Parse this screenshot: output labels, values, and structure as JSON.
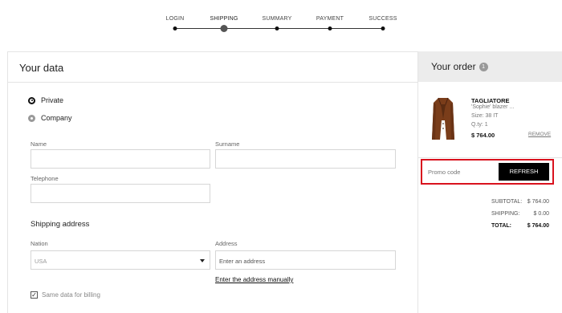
{
  "stepper": {
    "steps": [
      {
        "label": "LOGIN"
      },
      {
        "label": "SHIPPING"
      },
      {
        "label": "SUMMARY"
      },
      {
        "label": "PAYMENT"
      },
      {
        "label": "SUCCESS"
      }
    ]
  },
  "left": {
    "title": "Your data",
    "radio_private": "Private",
    "radio_company": "Company",
    "name_label": "Name",
    "surname_label": "Surname",
    "telephone_label": "Telephone",
    "shipping_title": "Shipping address",
    "nation_label": "Nation",
    "nation_value": "USA",
    "address_label": "Address",
    "address_placeholder": "Enter an address",
    "manual_link": "Enter the address manually",
    "billing_label": "Same data for billing",
    "billing_check": "✓"
  },
  "order": {
    "title": "Your order",
    "count": "1",
    "product": {
      "brand": "TAGLIATORE",
      "name": "'Sophie' blazer ...",
      "size": "Size: 38 IT",
      "qty": "Q.ty: 1",
      "price": "$ 764.00",
      "remove": "REMOVE"
    },
    "promo_placeholder": "Promo code",
    "refresh": "REFRESH",
    "subtotal_label": "SUBTOTAL:",
    "subtotal_value": "$ 764.00",
    "shipping_label": "SHIPPING:",
    "shipping_value": "$ 0.00",
    "total_label": "TOTAL:",
    "total_value": "$ 764.00"
  },
  "colors": {
    "highlight": "#d9121e",
    "button_bg": "#000000"
  }
}
